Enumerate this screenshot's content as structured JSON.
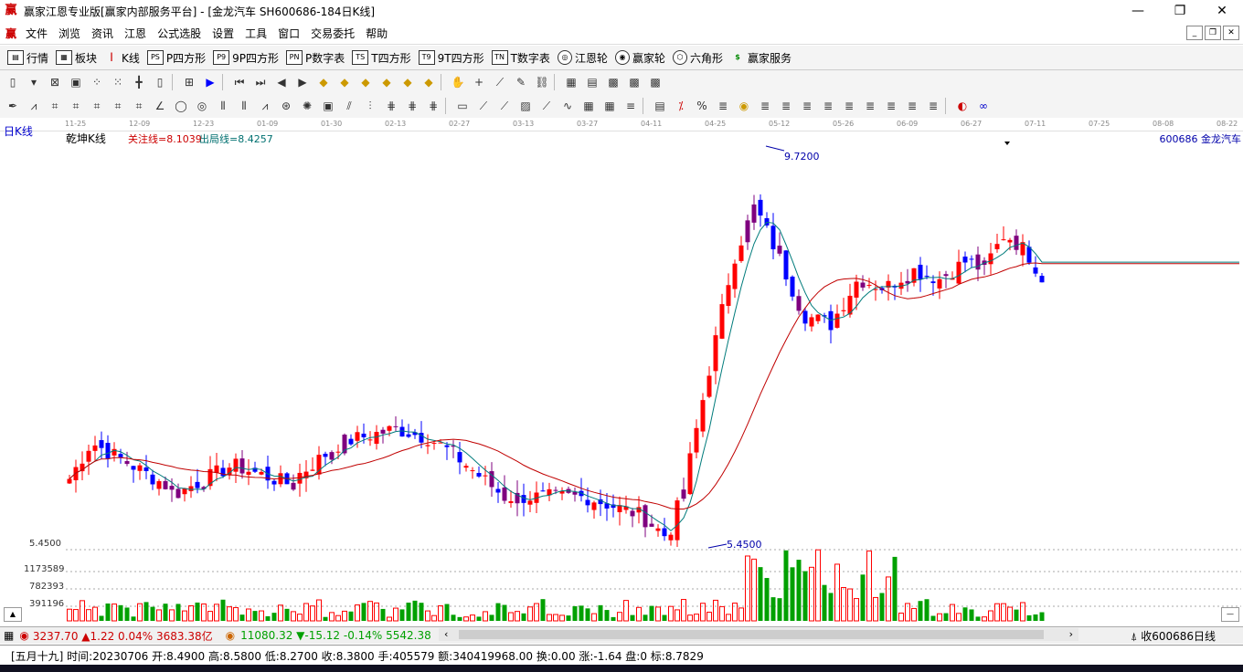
{
  "window": {
    "title": "赢家江恩专业版[赢家内部服务平台] - [金龙汽车  SH600686-184日K线]"
  },
  "menu": [
    "文件",
    "浏览",
    "资讯",
    "江恩",
    "公式选股",
    "设置",
    "工具",
    "窗口",
    "交易委托",
    "帮助"
  ],
  "toolbar1": [
    {
      "label": "行情",
      "icon": "quote-icon"
    },
    {
      "label": "板块",
      "icon": "sector-icon"
    },
    {
      "label": "K线",
      "icon": "kline-icon"
    },
    {
      "label": "P四方形",
      "icon": "PS"
    },
    {
      "label": "9P四方形",
      "icon": "P9"
    },
    {
      "label": "P数字表",
      "icon": "PN"
    },
    {
      "label": "T四方形",
      "icon": "TS"
    },
    {
      "label": "9T四方形",
      "icon": "T9"
    },
    {
      "label": "T数字表",
      "icon": "TN"
    },
    {
      "label": "江恩轮",
      "icon": "wheel-icon"
    },
    {
      "label": "赢家轮",
      "icon": "wheel2-icon"
    },
    {
      "label": "六角形",
      "icon": "hexagon-icon"
    },
    {
      "label": "赢家服务",
      "icon": "dollar-icon"
    }
  ],
  "chart": {
    "period": "日K线",
    "indicator": "乾坤K线",
    "attention_line": "关注线=8.1039",
    "exit_line": "出局线=8.4257",
    "stock": "600686 金龙汽车",
    "high_label": "9.7200",
    "low_label": "5.4500",
    "axis_price": "5.4500",
    "vol_labels": [
      "1173589",
      "782393",
      "391196"
    ],
    "dates": [
      "11-25",
      "12-09",
      "12-23",
      "01-09",
      "01-30",
      "02-13",
      "02-27",
      "03-13",
      "03-27",
      "04-11",
      "04-25",
      "05-12",
      "05-26",
      "06-09",
      "06-27",
      "07-11",
      "07-25",
      "08-08",
      "08-22"
    ]
  },
  "chart_data": {
    "type": "candlestick",
    "period": "日K线",
    "price_extremes": {
      "high": 9.72,
      "low": 5.45
    },
    "volume_ticks": [
      1173589,
      782393,
      391196
    ]
  },
  "status": {
    "sh": "3237.70 ▲1.22 0.04% 3683.38亿",
    "sz": "11080.32 ▼-15.12 -0.14% 5542.38",
    "right": "收600686日线"
  },
  "info": "[五月十九] 时间:20230706 开:8.4900 高:8.5800 低:8.2700 收:8.3800 手:405579 额:340419968.00 换:0.00 涨:-1.64 盘:0 标:8.7829",
  "colors": {
    "up": "#ff0000",
    "down": "#0000ff",
    "purple": "#7f007f",
    "vol_up": "#ff0000",
    "vol_down": "#00a000",
    "ma_slow": "#c00000",
    "ma_fast": "#007b7b"
  }
}
